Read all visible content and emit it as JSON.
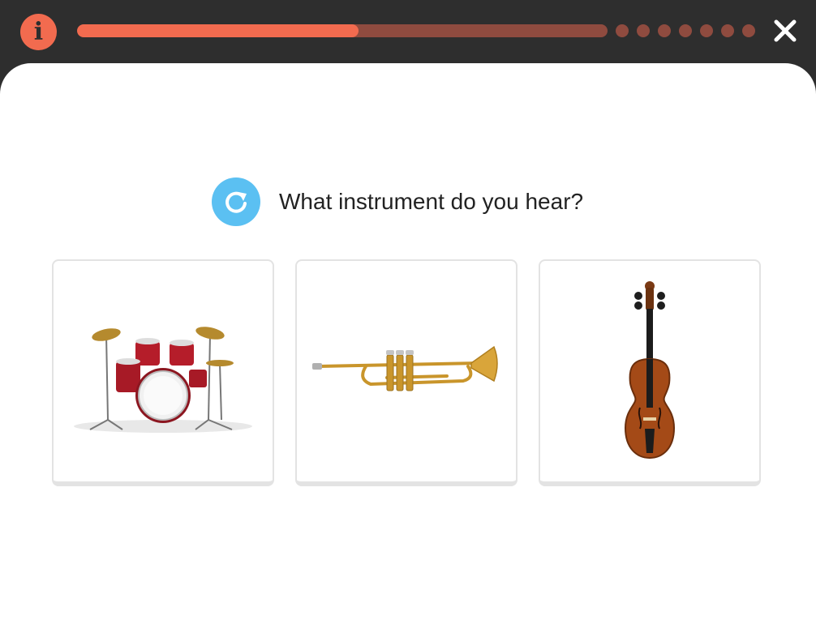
{
  "header": {
    "info_icon": "info-icon",
    "info_glyph": "i",
    "progress": 0.53,
    "remaining_steps": 7,
    "close_icon": "close-icon",
    "colors": {
      "background": "#2e2e2e",
      "accent": "#f26b4f",
      "inactive": "#8f4b3f"
    }
  },
  "question": {
    "replay_icon": "replay-icon",
    "text": "What instrument do you hear?",
    "replay_color": "#5bc0f2"
  },
  "options": [
    {
      "name": "drum-kit-option",
      "image": "drum-kit-image"
    },
    {
      "name": "trumpet-option",
      "image": "trumpet-image"
    },
    {
      "name": "violin-option",
      "image": "violin-image"
    }
  ]
}
